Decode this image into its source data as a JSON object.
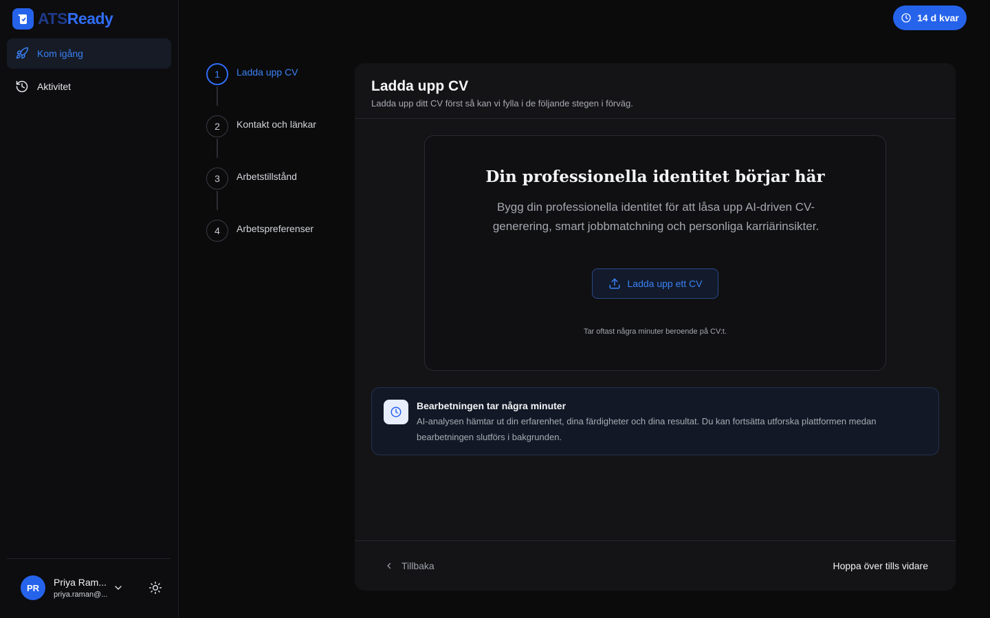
{
  "brand": {
    "name_part1": "ATS",
    "name_part2": "Ready"
  },
  "sidebar": {
    "items": [
      {
        "label": "Kom igång",
        "icon": "rocket-icon",
        "active": true
      },
      {
        "label": "Aktivitet",
        "icon": "history-icon",
        "active": false
      }
    ]
  },
  "user": {
    "initials": "PR",
    "name": "Priya Ram...",
    "email": "priya.raman@..."
  },
  "trial": {
    "label": "14 d kvar"
  },
  "steps": [
    {
      "number": "1",
      "label": "Ladda upp CV"
    },
    {
      "number": "2",
      "label": "Kontakt och länkar"
    },
    {
      "number": "3",
      "label": "Arbetstillstånd"
    },
    {
      "number": "4",
      "label": "Arbetspreferenser"
    }
  ],
  "panel": {
    "title": "Ladda upp CV",
    "subtitle": "Ladda upp ditt CV först så kan vi fylla i de följande stegen i förväg."
  },
  "upload": {
    "heading": "Din professionella identitet börjar här",
    "description": "Bygg din professionella identitet för att låsa upp AI-driven CV-generering, smart jobbmatchning och personliga karriärinsikter.",
    "button_label": "Ladda upp ett CV",
    "note": "Tar oftast några minuter beroende på CV:t."
  },
  "info": {
    "title": "Bearbetningen tar några minuter",
    "text": "AI-analysen hämtar ut din erfarenhet, dina färdigheter och dina resultat. Du kan fortsätta utforska plattformen medan bearbetningen slutförs i bakgrunden."
  },
  "footer": {
    "back_label": "Tillbaka",
    "skip_label": "Hoppa över tills vidare"
  },
  "colors": {
    "accent": "#2563eb",
    "background": "#0b0b0c",
    "panel": "#141416"
  }
}
